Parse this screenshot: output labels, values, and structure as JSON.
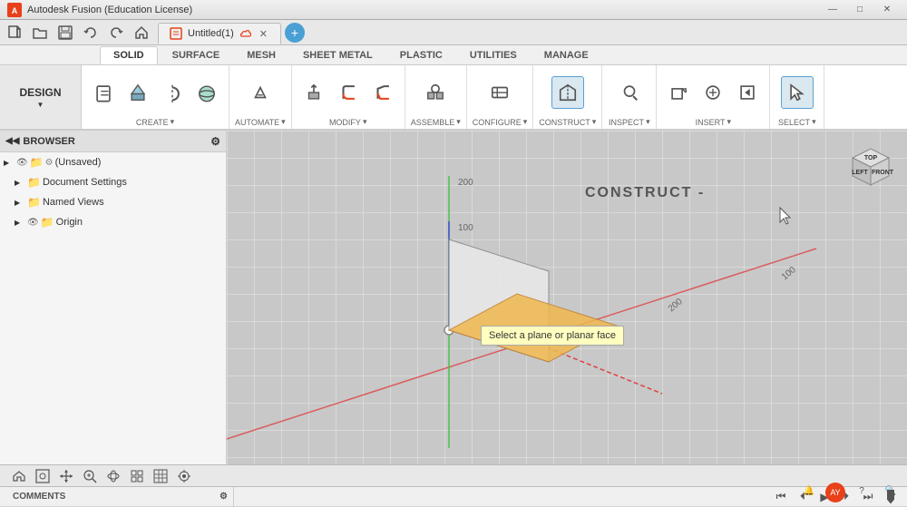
{
  "app": {
    "title": "Autodesk Fusion (Education License)",
    "document_title": "Untitled(1)"
  },
  "window_controls": {
    "minimize": "—",
    "maximize": "□",
    "close": "✕"
  },
  "design_dropdown": "DESIGN",
  "toolbar_tabs": [
    {
      "label": "SOLID",
      "active": true
    },
    {
      "label": "SURFACE",
      "active": false
    },
    {
      "label": "MESH",
      "active": false
    },
    {
      "label": "SHEET METAL",
      "active": false
    },
    {
      "label": "PLASTIC",
      "active": false
    },
    {
      "label": "UTILITIES",
      "active": false
    },
    {
      "label": "MANAGE",
      "active": false
    }
  ],
  "toolbar_groups": [
    {
      "id": "create",
      "label": "CREATE",
      "has_arrow": true,
      "buttons": [
        {
          "id": "new-component",
          "label": "",
          "icon": "new-component"
        },
        {
          "id": "extrude",
          "label": "",
          "icon": "extrude"
        },
        {
          "id": "revolve",
          "label": "",
          "icon": "revolve"
        },
        {
          "id": "sphere",
          "label": "",
          "icon": "sphere"
        }
      ]
    },
    {
      "id": "automate",
      "label": "AUTOMATE",
      "has_arrow": true,
      "buttons": [
        {
          "id": "automate-btn",
          "label": "",
          "icon": "automate"
        }
      ]
    },
    {
      "id": "modify",
      "label": "MODIFY",
      "has_arrow": true,
      "buttons": [
        {
          "id": "press-pull",
          "label": "",
          "icon": "press-pull"
        },
        {
          "id": "fillet",
          "label": "",
          "icon": "fillet"
        },
        {
          "id": "chamfer",
          "label": "",
          "icon": "chamfer"
        }
      ]
    },
    {
      "id": "assemble",
      "label": "ASSEMBLE",
      "has_arrow": true,
      "buttons": [
        {
          "id": "assemble-btn",
          "label": "",
          "icon": "assemble"
        }
      ]
    },
    {
      "id": "configure",
      "label": "CONFIGURE",
      "has_arrow": true,
      "buttons": [
        {
          "id": "configure-btn",
          "label": "",
          "icon": "configure"
        }
      ]
    },
    {
      "id": "construct",
      "label": "CONSTRUCT",
      "has_arrow": true,
      "buttons": [
        {
          "id": "construct-btn",
          "label": "",
          "icon": "construct",
          "active": true
        }
      ]
    },
    {
      "id": "inspect",
      "label": "INSPECT",
      "has_arrow": true,
      "buttons": [
        {
          "id": "inspect-btn",
          "label": "",
          "icon": "inspect"
        }
      ]
    },
    {
      "id": "insert",
      "label": "INSERT",
      "has_arrow": true,
      "buttons": [
        {
          "id": "insert1",
          "label": "",
          "icon": "insert1"
        },
        {
          "id": "insert2",
          "label": "",
          "icon": "insert2"
        },
        {
          "id": "insert3",
          "label": "",
          "icon": "insert3"
        }
      ]
    },
    {
      "id": "select",
      "label": "SELECT",
      "has_arrow": true,
      "buttons": [
        {
          "id": "select-btn",
          "label": "",
          "icon": "select",
          "active": true
        }
      ]
    }
  ],
  "browser": {
    "title": "BROWSER",
    "items": [
      {
        "id": "unsaved",
        "label": "(Unsaved)",
        "level": 0,
        "has_expand": true,
        "is_eye": true,
        "is_settings": true
      },
      {
        "id": "doc-settings",
        "label": "Document Settings",
        "level": 1,
        "has_expand": true
      },
      {
        "id": "named-views",
        "label": "Named Views",
        "level": 1,
        "has_expand": true
      },
      {
        "id": "origin",
        "label": "Origin",
        "level": 1,
        "has_expand": true,
        "is_eye": true
      }
    ]
  },
  "canvas": {
    "tooltip": "Select a plane or planar face",
    "construct_label": "CONSTRUCT -"
  },
  "bottom_toolbar": {
    "buttons": [
      "home",
      "fit",
      "pan",
      "zoom",
      "look",
      "display-settings",
      "grid-settings",
      "view-settings"
    ]
  },
  "comments": {
    "label": "COMMENTS"
  },
  "timeline": {
    "play_prev": "⏮",
    "step_back": "⏴",
    "play": "▶",
    "step_fwd": "⏵",
    "play_next": "⏭"
  }
}
